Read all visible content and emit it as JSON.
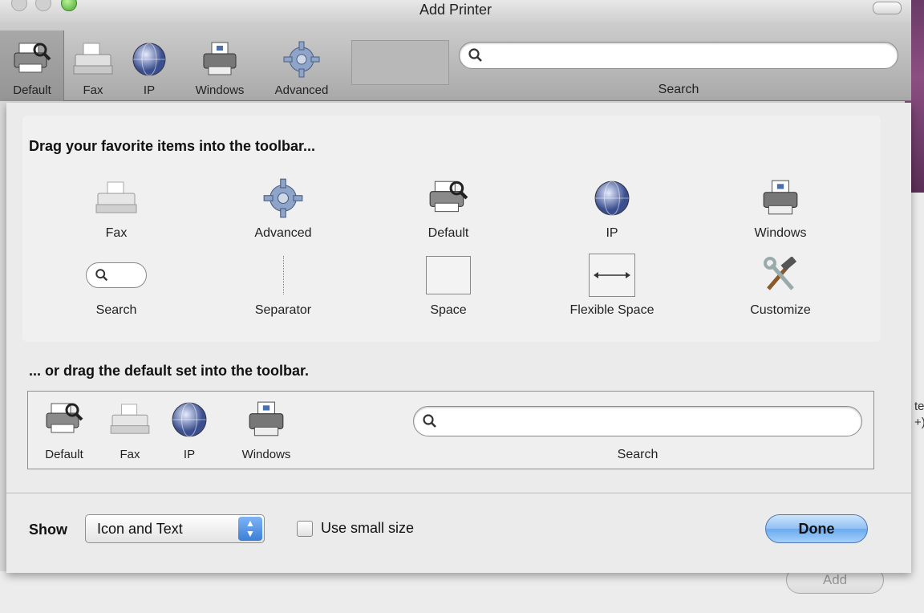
{
  "window": {
    "title": "Add Printer"
  },
  "toolbar": {
    "items": [
      {
        "label": "Default",
        "icon": "default-printer-icon"
      },
      {
        "label": "Fax",
        "icon": "fax-icon"
      },
      {
        "label": "IP",
        "icon": "ip-globe-icon"
      },
      {
        "label": "Windows",
        "icon": "windows-printer-icon"
      },
      {
        "label": "Advanced",
        "icon": "advanced-gear-icon"
      }
    ],
    "search_label": "Search"
  },
  "sheet": {
    "palette_heading": "Drag your favorite items into the toolbar...",
    "palette": [
      {
        "label": "Fax",
        "icon": "fax-icon"
      },
      {
        "label": "Advanced",
        "icon": "advanced-gear-icon"
      },
      {
        "label": "Default",
        "icon": "default-printer-icon"
      },
      {
        "label": "IP",
        "icon": "ip-globe-icon"
      },
      {
        "label": "Windows",
        "icon": "windows-printer-icon"
      },
      {
        "label": "Search",
        "icon": "search-field-icon"
      },
      {
        "label": "Separator",
        "icon": "separator-icon"
      },
      {
        "label": "Space",
        "icon": "space-icon"
      },
      {
        "label": "Flexible Space",
        "icon": "flexible-space-icon"
      },
      {
        "label": "Customize",
        "icon": "customize-tools-icon"
      }
    ],
    "default_heading": "... or drag the default set into the toolbar.",
    "default_set": [
      {
        "label": "Default",
        "icon": "default-printer-icon"
      },
      {
        "label": "Fax",
        "icon": "fax-icon"
      },
      {
        "label": "IP",
        "icon": "ip-globe-icon"
      },
      {
        "label": "Windows",
        "icon": "windows-printer-icon"
      }
    ],
    "default_search_label": "Search",
    "show_label": "Show",
    "show_value": "Icon and Text",
    "small_size_label": "Use small size",
    "small_size_checked": false,
    "done_label": "Done"
  },
  "background": {
    "add_label": "Add",
    "edge_text": "te\n+)"
  },
  "colors": {
    "done_button": "#8fc0f3",
    "window_edge": "#8b4f82"
  }
}
